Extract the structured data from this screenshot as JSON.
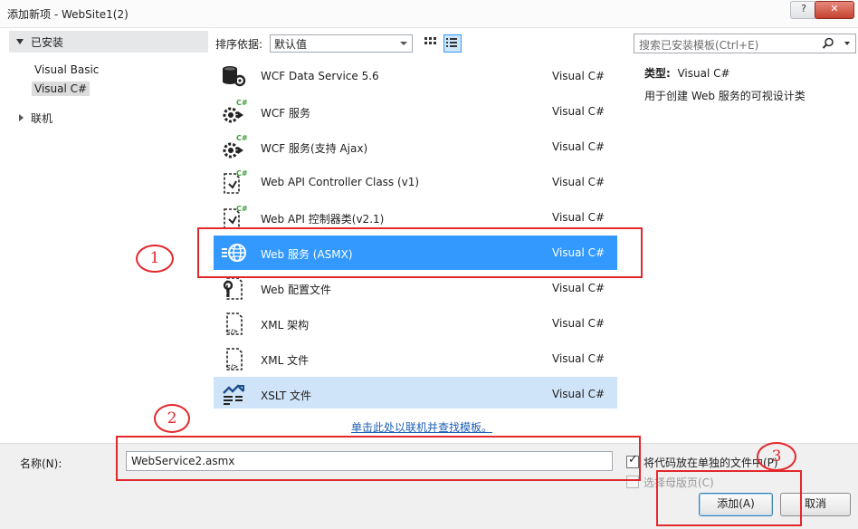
{
  "window": {
    "title": "添加新项 - WebSite1(2)",
    "help_glyph": "?",
    "close_glyph": "✕"
  },
  "sidebar": {
    "installed_label": "已安装",
    "languages": [
      "Visual Basic",
      "Visual C#"
    ],
    "selected_language": "Visual C#",
    "online_label": "联机"
  },
  "toolbar": {
    "sort_label": "排序依据:",
    "sort_value": "默认值",
    "search_placeholder": "搜索已安装模板(Ctrl+E)"
  },
  "templates": [
    {
      "name": "WCF Data Service 5.6",
      "type": "Visual C#",
      "icon": "data-service-icon",
      "cs_badge": false,
      "state": ""
    },
    {
      "name": "WCF 服务",
      "type": "Visual C#",
      "icon": "wcf-service-icon",
      "cs_badge": true,
      "state": ""
    },
    {
      "name": "WCF 服务(支持 Ajax)",
      "type": "Visual C#",
      "icon": "wcf-ajax-service-icon",
      "cs_badge": true,
      "state": ""
    },
    {
      "name": "Web API Controller Class (v1)",
      "type": "Visual C#",
      "icon": "web-api-controller-icon",
      "cs_badge": true,
      "state": ""
    },
    {
      "name": "Web API 控制器类(v2.1)",
      "type": "Visual C#",
      "icon": "web-api-controller-v2-icon",
      "cs_badge": true,
      "state": ""
    },
    {
      "name": "Web 服务 (ASMX)",
      "type": "Visual C#",
      "icon": "web-service-asmx-icon",
      "cs_badge": false,
      "state": "selected"
    },
    {
      "name": "Web 配置文件",
      "type": "Visual C#",
      "icon": "web-config-icon",
      "cs_badge": false,
      "state": ""
    },
    {
      "name": "XML 架构",
      "type": "Visual C#",
      "icon": "xml-schema-icon",
      "cs_badge": false,
      "state": ""
    },
    {
      "name": "XML 文件",
      "type": "Visual C#",
      "icon": "xml-file-icon",
      "cs_badge": false,
      "state": ""
    },
    {
      "name": "XSLT 文件",
      "type": "Visual C#",
      "icon": "xslt-file-icon",
      "cs_badge": false,
      "state": "hover"
    }
  ],
  "details": {
    "type_label": "类型:",
    "type_value": "Visual C#",
    "description": "用于创建 Web 服务的可视设计类"
  },
  "online_link": "单击此处以联机并查找模板。",
  "bottom": {
    "name_label": "名称(N):",
    "name_value": "WebService2.asmx",
    "code_separate_label": "将代码放在单独的文件中(P)",
    "code_separate_checked": true,
    "master_page_label": "选择母版页(C)",
    "master_page_checked": false,
    "add_button": "添加(A)",
    "cancel_button": "取消"
  },
  "annotations": {
    "marker_1": "1",
    "marker_2": "2",
    "marker_3": "3",
    "color": "#e3282c"
  },
  "colors": {
    "selection": "#3399ff",
    "hover": "#cfe4f8",
    "link": "#1a5fb4"
  }
}
